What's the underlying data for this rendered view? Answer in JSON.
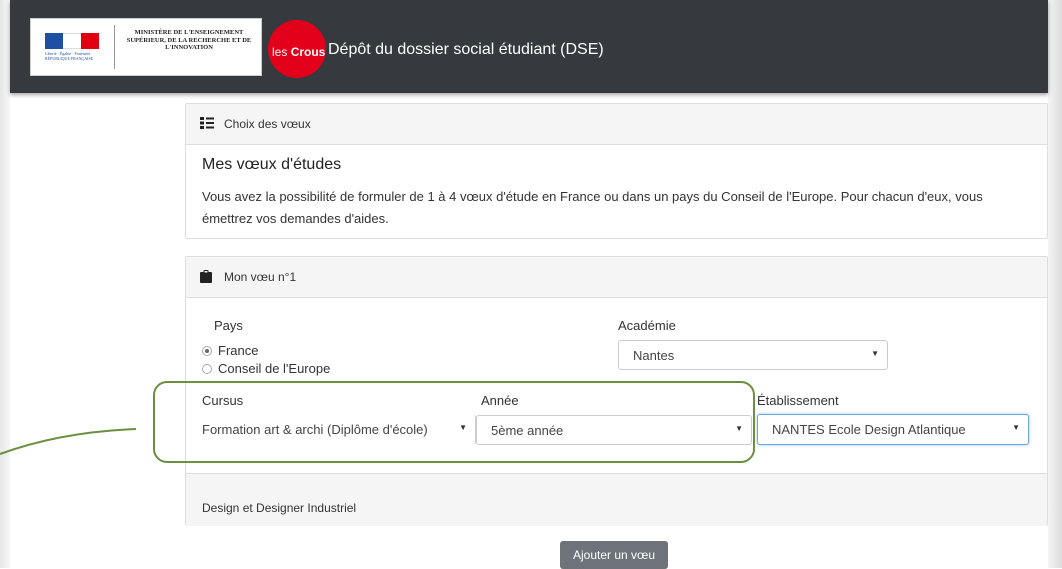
{
  "header": {
    "gov_logo_text": "MINISTÈRE DE L'ENSEIGNEMENT SUPÉRIEUR, DE LA RECHERCHE ET DE L'INNOVATION",
    "gov_devise": "Liberté · Égalité · Fraternité",
    "gov_republique": "RÉPUBLIQUE FRANÇAISE",
    "crous_prefix": "les",
    "crous_name": "Crous",
    "title": "Dépôt du dossier social étudiant (DSE)"
  },
  "choix": {
    "header_label": "Choix des vœux",
    "heading": "Mes vœux d'études",
    "text": "Vous avez la possibilité de formuler de 1 à 4 vœux d'étude en France ou dans un pays du Conseil de l'Europe. Pour chacun d'eux, vous émettrez vos demandes d'aides."
  },
  "voeu": {
    "header_label": "Mon vœu n°1",
    "pays_label": "Pays",
    "pays_options": [
      "France",
      "Conseil de l'Europe"
    ],
    "pays_selected": "France",
    "academie_label": "Académie",
    "academie_value": "Nantes",
    "cursus_label": "Cursus",
    "cursus_value": "Formation art & archi (Diplôme d'école)",
    "annee_label": "Année",
    "annee_value": "5ème année",
    "etablissement_label": "Établissement",
    "etablissement_value": "NANTES Ecole Design Atlantique",
    "formation": "Design et Designer Industriel"
  },
  "actions": {
    "add_label": "Ajouter un vœu"
  },
  "colors": {
    "header_bg": "#36393d",
    "crous_red": "#e2001a",
    "highlight_green": "#6b8f3e",
    "button_gray": "#6d7378"
  },
  "icons": [
    "marianne-logo",
    "list-icon",
    "clipboard-icon",
    "chevron-down-icon"
  ]
}
